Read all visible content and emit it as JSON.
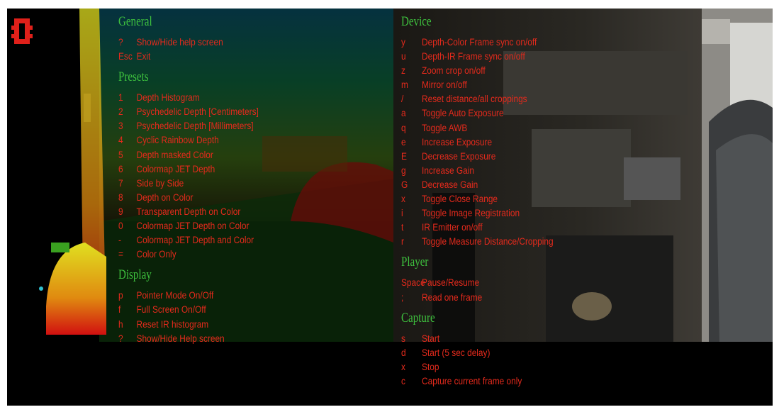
{
  "sections": {
    "general": {
      "title": "General",
      "items": [
        {
          "key": "?",
          "label": "Show/Hide help screen"
        },
        {
          "key": "Esc",
          "label": "Exit"
        }
      ]
    },
    "presets": {
      "title": "Presets",
      "items": [
        {
          "key": "1",
          "label": "Depth Histogram"
        },
        {
          "key": "2",
          "label": "Psychedelic Depth [Centimeters]"
        },
        {
          "key": "3",
          "label": "Psychedelic Depth [Millimeters]"
        },
        {
          "key": "4",
          "label": "Cyclic Rainbow Depth"
        },
        {
          "key": "5",
          "label": "Depth masked Color"
        },
        {
          "key": "6",
          "label": "Colormap JET Depth"
        },
        {
          "key": "7",
          "label": "Side by Side"
        },
        {
          "key": "8",
          "label": "Depth on Color"
        },
        {
          "key": "9",
          "label": "Transparent Depth on Color"
        },
        {
          "key": "0",
          "label": "Colormap JET Depth on Color"
        },
        {
          "key": "-",
          "label": "Colormap JET Depth and Color"
        },
        {
          "key": "=",
          "label": "Color Only"
        }
      ]
    },
    "display": {
      "title": "Display",
      "items": [
        {
          "key": "p",
          "label": "Pointer Mode On/Off"
        },
        {
          "key": "f",
          "label": "Full Screen On/Off"
        },
        {
          "key": "h",
          "label": "Reset IR histogram"
        },
        {
          "key": "?",
          "label": "Show/Hide Help screen"
        }
      ]
    },
    "device": {
      "title": "Device",
      "items": [
        {
          "key": "y",
          "label": "Depth-Color Frame sync on/off"
        },
        {
          "key": "u",
          "label": "Depth-IR Frame sync on/off"
        },
        {
          "key": "z",
          "label": "Zoom crop on/off"
        },
        {
          "key": "m",
          "label": "Mirror on/off"
        },
        {
          "key": "/",
          "label": "Reset distance/all croppings"
        },
        {
          "key": "a",
          "label": "Toggle Auto Exposure"
        },
        {
          "key": "q",
          "label": "Toggle AWB"
        },
        {
          "key": "e",
          "label": "Increase Exposure"
        },
        {
          "key": "E",
          "label": "Decrease Exposure"
        },
        {
          "key": "g",
          "label": "Increase Gain"
        },
        {
          "key": "G",
          "label": "Decrease Gain"
        },
        {
          "key": "x",
          "label": "Toggle Close Range"
        },
        {
          "key": "i",
          "label": "Toggle Image Registration"
        },
        {
          "key": "t",
          "label": "IR Emitter on/off"
        },
        {
          "key": "r",
          "label": "Toggle Measure Distance/Cropping"
        }
      ]
    },
    "player": {
      "title": "Player",
      "items": [
        {
          "key": "Space",
          "label": "Pause/Resume"
        },
        {
          "key": ";",
          "label": "Read one frame"
        }
      ]
    },
    "capture": {
      "title": "Capture",
      "items": [
        {
          "key": "s",
          "label": "Start"
        },
        {
          "key": "d",
          "label": "Start (5 sec delay)"
        },
        {
          "key": "x",
          "label": "Stop"
        },
        {
          "key": "c",
          "label": "Capture current frame only"
        }
      ]
    }
  },
  "colors": {
    "section_title": "#3ec13e",
    "item_text": "#e52a1c",
    "background": "#000000"
  },
  "icons": {
    "logo": "red-square-logo-icon"
  }
}
